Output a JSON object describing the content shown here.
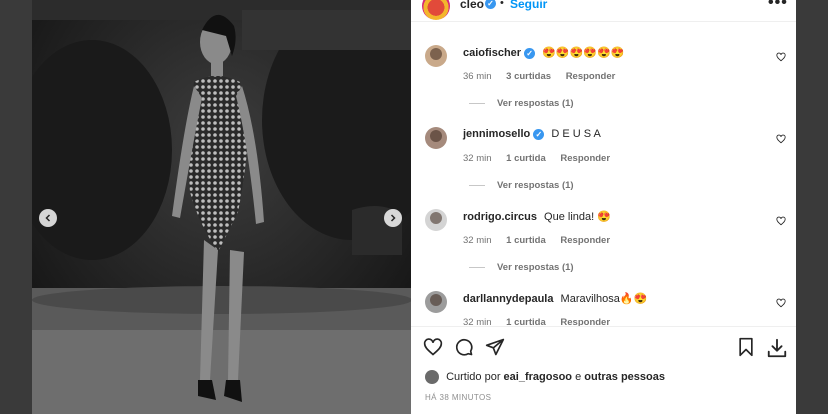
{
  "post": {
    "username": "cleo",
    "separator": "•",
    "follow_label": "Seguir",
    "more_icon": "more-horizontal-icon",
    "more_label": "•••"
  },
  "comments": [
    {
      "username": "caiofischer",
      "verified": true,
      "text": "😍😍😍😍😍😍",
      "time": "36 min",
      "likes": "3 curtidas",
      "reply_label": "Responder",
      "replies": "Ver respostas (1)"
    },
    {
      "username": "jennimosello",
      "verified": true,
      "text": "D E U S A",
      "time": "32 min",
      "likes": "1 curtida",
      "reply_label": "Responder",
      "replies": "Ver respostas (1)"
    },
    {
      "username": "rodrigo.circus",
      "verified": false,
      "text": "Que linda! 😍",
      "time": "32 min",
      "likes": "1 curtida",
      "reply_label": "Responder",
      "replies": "Ver respostas (1)"
    },
    {
      "username": "darllannydepaula",
      "verified": false,
      "text": "Maravilhosa🔥😍",
      "time": "32 min",
      "likes": "1 curtida",
      "reply_label": "Responder",
      "replies": ""
    }
  ],
  "verified_mark": "✓",
  "liked_by": {
    "prefix": "Curtido por",
    "user": "eai_fragosoo",
    "suffix": "e",
    "others": "outras pessoas"
  },
  "timestamp": "HÁ 38 MINUTOS",
  "colors": {
    "accent": "#0095f6",
    "verified": "#3897f0",
    "text": "#262626",
    "muted": "#737373"
  }
}
